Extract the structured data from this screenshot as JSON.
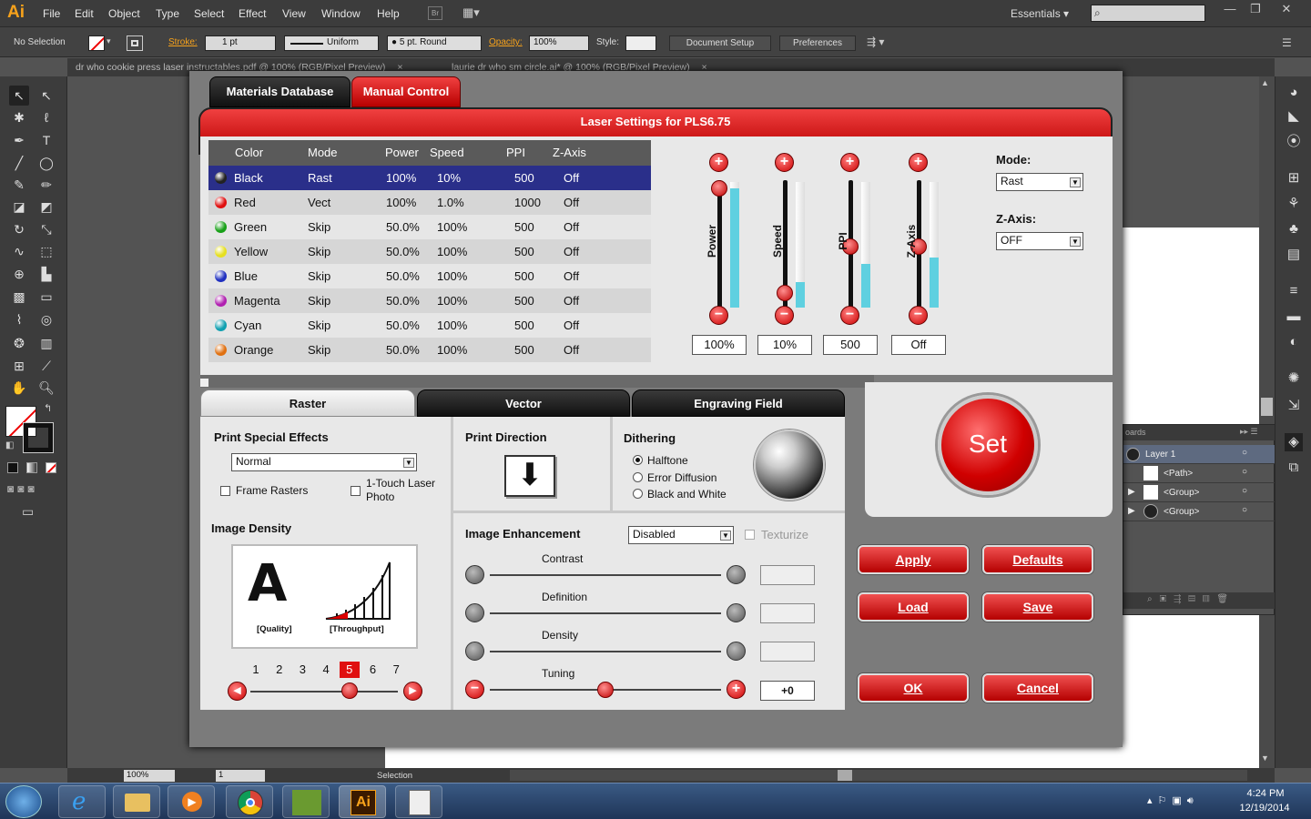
{
  "app": {
    "logo": "Ai",
    "menus": [
      "File",
      "Edit",
      "Object",
      "Type",
      "Select",
      "Effect",
      "View",
      "Window",
      "Help"
    ],
    "workspace": "Essentials",
    "window_buttons": [
      "—",
      "❐",
      "✕"
    ]
  },
  "control_bar": {
    "selection": "No Selection",
    "stroke_label": "Stroke:",
    "stroke_weight": "1 pt",
    "stroke_profile": "Uniform",
    "brush": "5 pt. Round",
    "opacity_label": "Opacity:",
    "opacity_value": "100%",
    "style_label": "Style:",
    "document_setup": "Document Setup",
    "preferences": "Preferences"
  },
  "doc_tabs": [
    {
      "label": "dr who cookie press laser instructables.pdf @ 100% (RGB/Pixel Preview)"
    },
    {
      "label": "laurie dr who sm circle.ai* @ 100% (RGB/Pixel Preview)"
    }
  ],
  "layers_panel": {
    "header": "oards",
    "rows": [
      {
        "label": "Layer 1"
      },
      {
        "label": "<Path>"
      },
      {
        "label": "<Group>"
      },
      {
        "label": "<Group>"
      }
    ]
  },
  "status_bar": {
    "zoom": "100%",
    "page": "1",
    "mode": "Selection"
  },
  "taskbar": {
    "time": "4:24 PM",
    "date": "12/19/2014"
  },
  "dialog": {
    "tabs": {
      "materials": "Materials Database",
      "manual": "Manual Control"
    },
    "title": "Laser Settings for PLS6.75",
    "table": {
      "headers": [
        "Color",
        "Mode",
        "Power",
        "Speed",
        "PPI",
        "Z-Axis"
      ],
      "rows": [
        {
          "color": "Black",
          "mode": "Rast",
          "power": "100%",
          "speed": "10%",
          "ppi": "500",
          "z": "Off",
          "ball": "#222222"
        },
        {
          "color": "Red",
          "mode": "Vect",
          "power": "100%",
          "speed": "1.0%",
          "ppi": "1000",
          "z": "Off",
          "ball": "#e01010"
        },
        {
          "color": "Green",
          "mode": "Skip",
          "power": "50.0%",
          "speed": "100%",
          "ppi": "500",
          "z": "Off",
          "ball": "#18a018"
        },
        {
          "color": "Yellow",
          "mode": "Skip",
          "power": "50.0%",
          "speed": "100%",
          "ppi": "500",
          "z": "Off",
          "ball": "#e6e020"
        },
        {
          "color": "Blue",
          "mode": "Skip",
          "power": "50.0%",
          "speed": "100%",
          "ppi": "500",
          "z": "Off",
          "ball": "#2030c0"
        },
        {
          "color": "Magenta",
          "mode": "Skip",
          "power": "50.0%",
          "speed": "100%",
          "ppi": "500",
          "z": "Off",
          "ball": "#b020b0"
        },
        {
          "color": "Cyan",
          "mode": "Skip",
          "power": "50.0%",
          "speed": "100%",
          "ppi": "500",
          "z": "Off",
          "ball": "#10a0b0"
        },
        {
          "color": "Orange",
          "mode": "Skip",
          "power": "50.0%",
          "speed": "100%",
          "ppi": "500",
          "z": "Off",
          "ball": "#e07010"
        }
      ]
    },
    "sliders": [
      {
        "label": "Power",
        "value": "100%",
        "level": 1.0,
        "meter": 0.95
      },
      {
        "label": "Speed",
        "value": "10%",
        "level": 0.1,
        "meter": 0.2
      },
      {
        "label": "PPI",
        "value": "500",
        "level": 0.5,
        "meter": 0.35
      },
      {
        "label": "Z-Axis",
        "value": "Off",
        "level": 0.5,
        "meter": 0.4
      }
    ],
    "mode_label": "Mode:",
    "mode_value": "Rast",
    "zaxis_label": "Z-Axis:",
    "zaxis_value": "OFF",
    "lower_tabs": {
      "raster": "Raster",
      "vector": "Vector",
      "engraving": "Engraving Field"
    },
    "raster": {
      "print_special_effects": "Print Special Effects",
      "effect_value": "Normal",
      "frame_rasters": "Frame Rasters",
      "one_touch": "1-Touch Laser Photo",
      "image_density": "Image Density",
      "quality": "[Quality]",
      "throughput": "[Throughput]",
      "density_steps": [
        "1",
        "2",
        "3",
        "4",
        "5",
        "6",
        "7"
      ],
      "density_selected": 5,
      "print_direction": "Print Direction",
      "dithering": "Dithering",
      "dither_options": [
        "Halftone",
        "Error Diffusion",
        "Black and White"
      ],
      "dither_selected": 0,
      "image_enhancement": "Image Enhancement",
      "enhancement_value": "Disabled",
      "texturize": "Texturize",
      "contrast": "Contrast",
      "definition": "Definition",
      "density": "Density",
      "tuning": "Tuning",
      "tuning_value": "+0",
      "tuning_level": 0.5
    },
    "set": "Set",
    "buttons": {
      "apply": "Apply",
      "defaults": "Defaults",
      "load": "Load",
      "save": "Save",
      "ok": "OK",
      "cancel": "Cancel"
    }
  }
}
